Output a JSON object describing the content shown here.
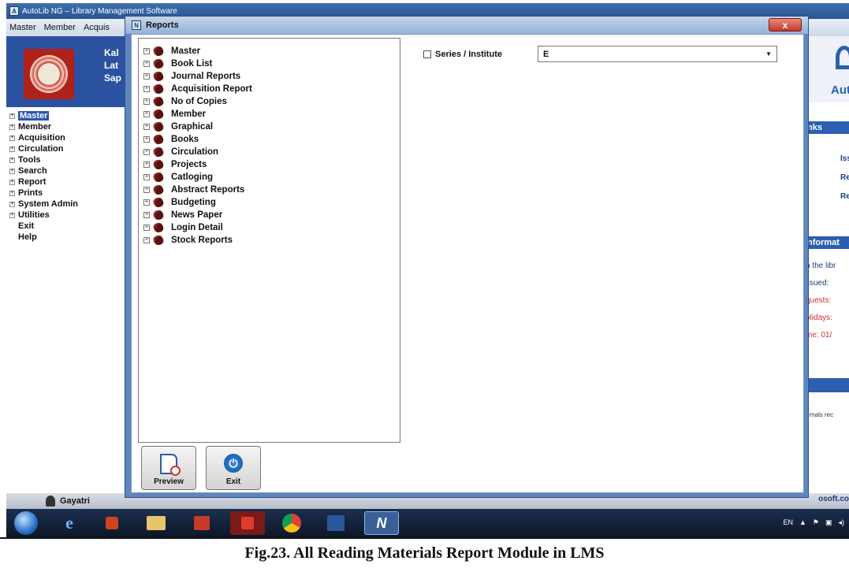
{
  "main_window": {
    "title": "AutoLib NG – Library Management Software",
    "menu": [
      "Master",
      "Member",
      "Acquis"
    ],
    "banner_lines": [
      "Kal",
      "Lat",
      "Sap"
    ],
    "nav": [
      {
        "label": "Master",
        "selected": true,
        "expand": true
      },
      {
        "label": "Member",
        "expand": true
      },
      {
        "label": "Acquisition",
        "expand": true
      },
      {
        "label": "Circulation",
        "expand": true
      },
      {
        "label": "Tools",
        "expand": true
      },
      {
        "label": "Search",
        "expand": true
      },
      {
        "label": "Report",
        "expand": true
      },
      {
        "label": "Prints",
        "expand": true
      },
      {
        "label": "System Admin",
        "expand": true
      },
      {
        "label": "Utilities",
        "expand": true
      },
      {
        "label": "Exit",
        "expand": false
      },
      {
        "label": "Help",
        "expand": false
      }
    ],
    "right_panel": {
      "brand": "Aut",
      "links_header": "nks",
      "links": [
        "Iss",
        "Re",
        "Re"
      ],
      "info_header": "nformat",
      "info_lines": [
        "n the libr",
        "ssued:",
        "quests:",
        "olidays:",
        "me: 01/"
      ],
      "footer_text": "urnals rec"
    },
    "status_user": "Gayatri",
    "status_right": "osoft.co"
  },
  "reports_dialog": {
    "title": "Reports",
    "close_label": "x",
    "tree": [
      "Master",
      "Book List",
      "Journal Reports",
      "Acquisition Report",
      "No of Copies",
      "Member",
      "Graphical",
      "Books",
      "Circulation",
      "Projects",
      "Catloging",
      "Abstract Reports",
      "Budgeting",
      "News Paper",
      "Login Detail",
      "Stock Reports"
    ],
    "preview_label": "Preview",
    "exit_label": "Exit",
    "series_label": "Series / Institute",
    "series_value": "E"
  },
  "taskbar": {
    "tray": [
      "EN"
    ]
  },
  "caption": "Fig.23. All Reading Materials Report Module in LMS",
  "colors": {
    "accent_blue": "#2c5fb0",
    "dialog_frame": "#5e86c0",
    "book_icon": "#5a1010"
  }
}
